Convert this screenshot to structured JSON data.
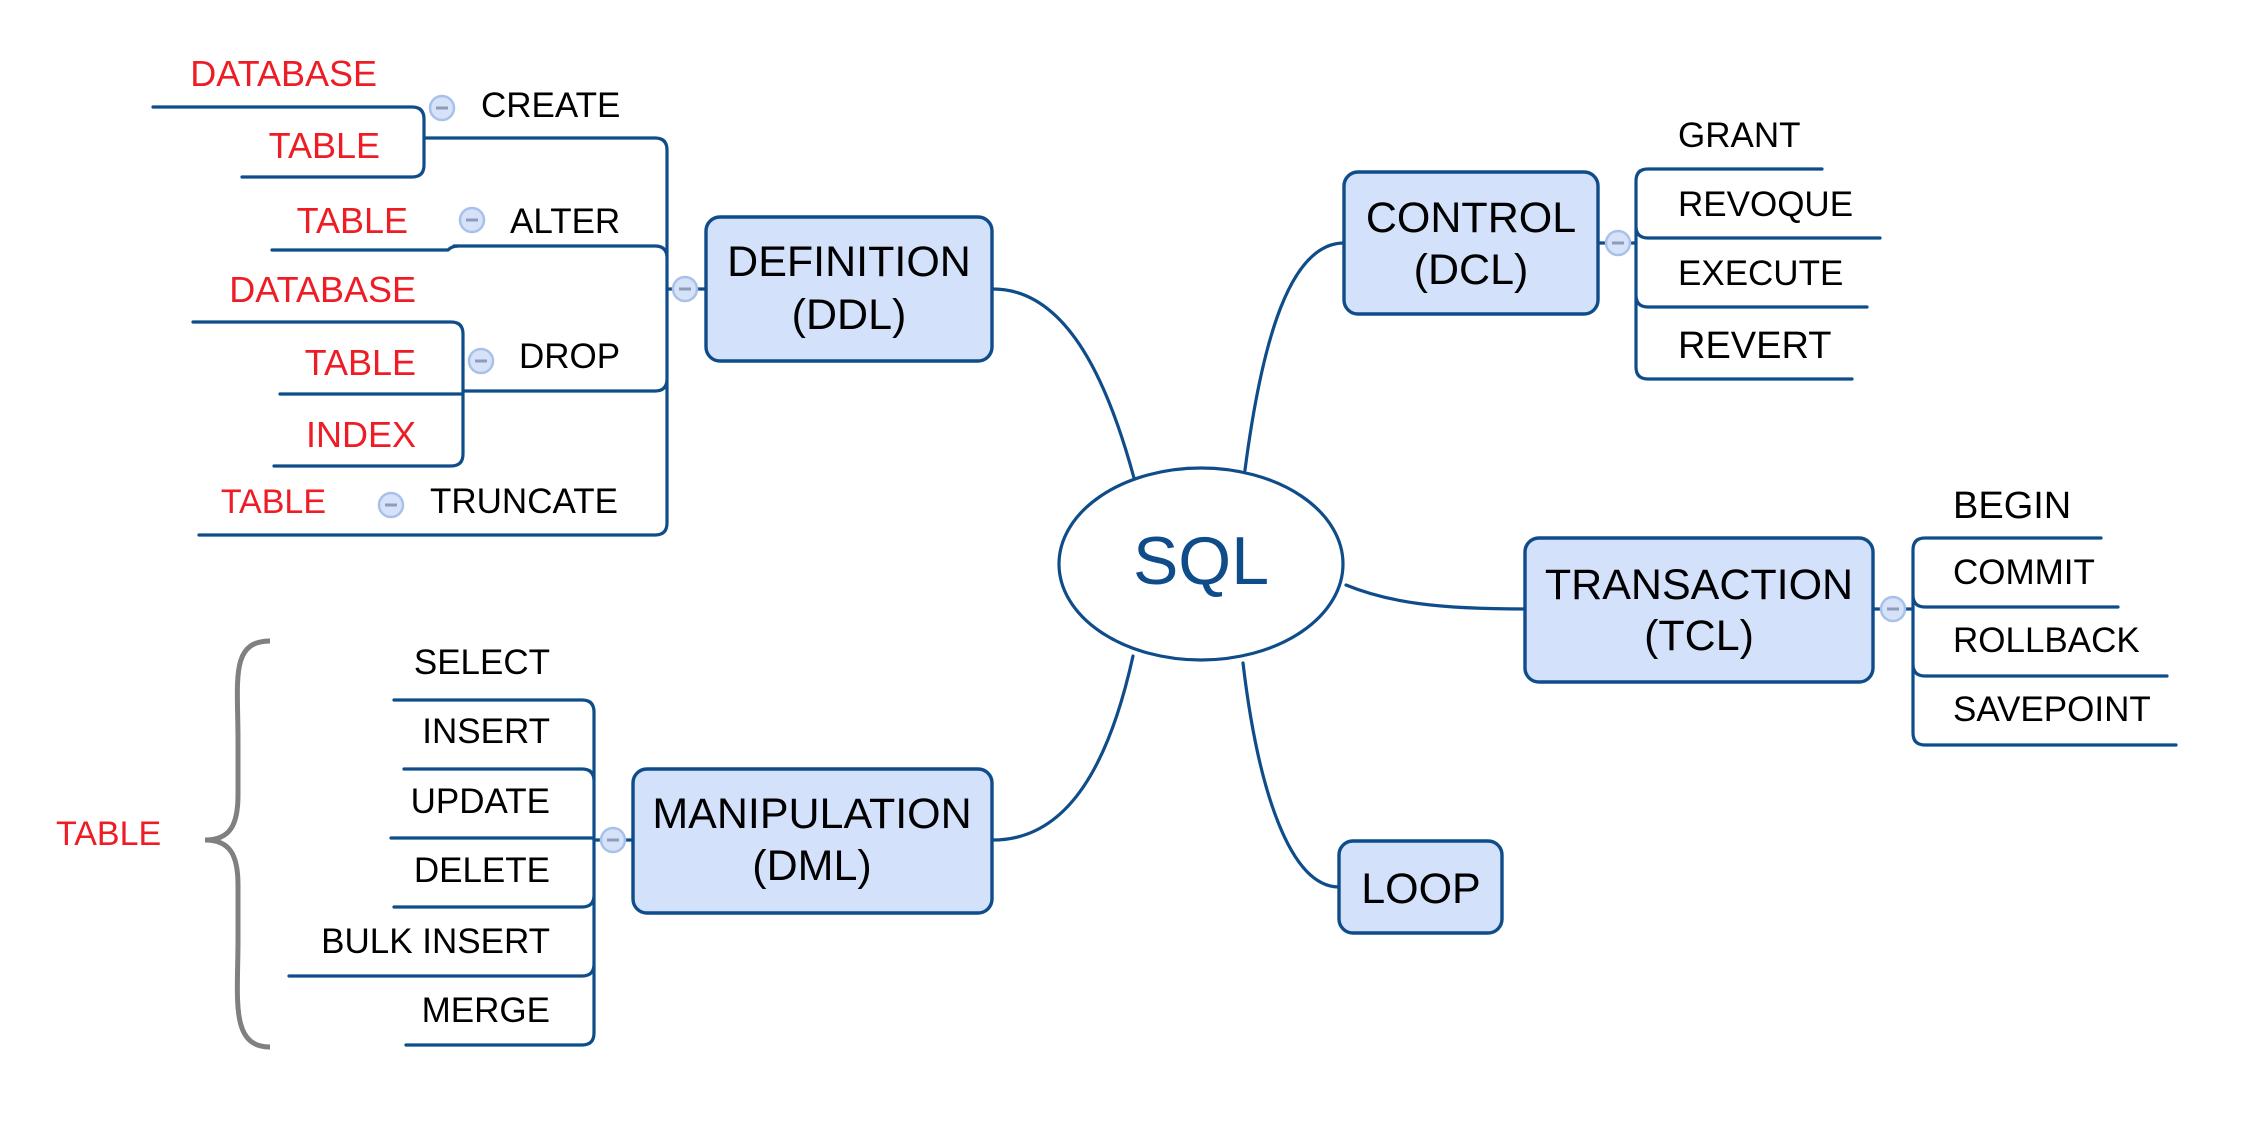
{
  "root": {
    "label": "SQL"
  },
  "colors": {
    "line": "#0f4c8a",
    "box_fill": "#d3e1fb",
    "root_text": "#0f4c8a",
    "object_text": "#ee1c25",
    "brace": "#808080",
    "collapse_fill": "#d6e2f7"
  },
  "branches": {
    "ddl": {
      "title": "DEFINITION",
      "subtitle": "(DDL)",
      "collapse_icon": "minus-circle",
      "commands": {
        "create": {
          "label": "CREATE",
          "objects": [
            "DATABASE",
            "TABLE"
          ]
        },
        "alter": {
          "label": "ALTER",
          "objects": [
            "TABLE"
          ]
        },
        "drop": {
          "label": "DROP",
          "objects": [
            "DATABASE",
            "TABLE",
            "INDEX"
          ]
        },
        "truncate": {
          "label": "TRUNCATE",
          "objects": [
            "TABLE"
          ]
        }
      }
    },
    "dml": {
      "title": "MANIPULATION",
      "subtitle": "(DML)",
      "collapse_icon": "minus-circle",
      "commands": [
        "SELECT",
        "INSERT",
        "UPDATE",
        "DELETE",
        "BULK INSERT",
        "MERGE"
      ],
      "applies_to": "TABLE"
    },
    "dcl": {
      "title": "CONTROL",
      "subtitle": "(DCL)",
      "collapse_icon": "minus-circle",
      "commands": [
        "GRANT",
        "REVOQUE",
        "EXECUTE",
        "REVERT"
      ]
    },
    "tcl": {
      "title": "TRANSACTION",
      "subtitle": "(TCL)",
      "collapse_icon": "minus-circle",
      "commands": [
        "BEGIN",
        "COMMIT",
        "ROLLBACK",
        "SAVEPOINT"
      ]
    },
    "loop": {
      "title": "LOOP"
    }
  }
}
